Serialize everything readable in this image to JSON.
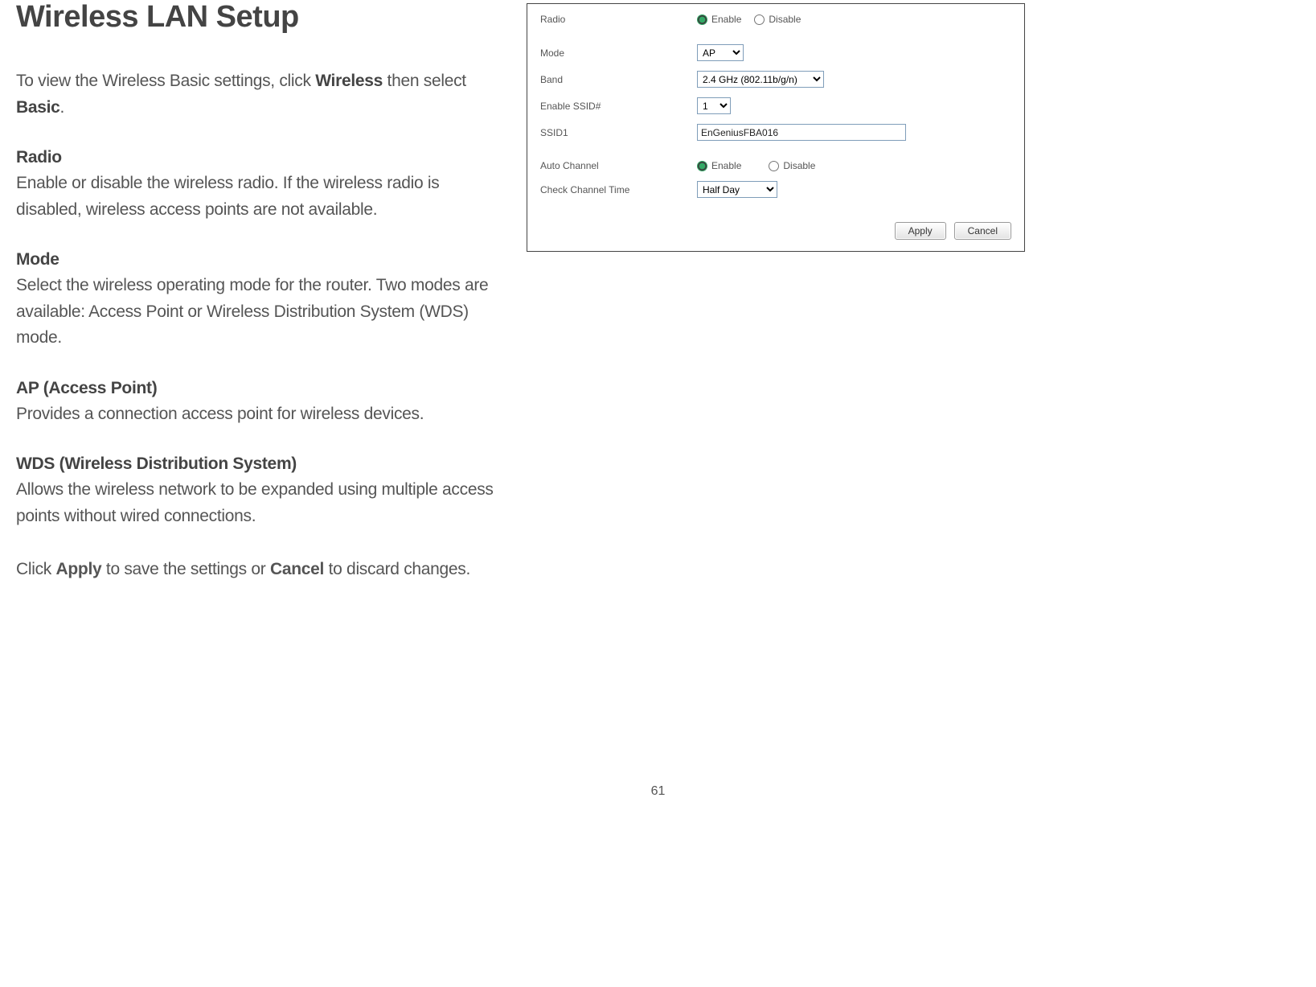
{
  "title": "Wireless LAN Setup",
  "intro": {
    "pre": "To view the Wireless Basic settings, click ",
    "bold1": "Wireless",
    "mid": " then select ",
    "bold2": "Basic",
    "post": "."
  },
  "sections": {
    "radio": {
      "head": "Radio",
      "desc": "Enable or disable the wireless radio. If the wireless radio is disabled, wireless access points are not available."
    },
    "mode": {
      "head": "Mode",
      "desc": "Select the wireless operating mode for the router. Two modes are available: Access Point or Wireless Distribution System (WDS) mode."
    },
    "ap": {
      "head": "AP (Access Point)",
      "desc": "Provides a connection access point for wireless devices."
    },
    "wds": {
      "head": "WDS (Wireless Distribution System)",
      "desc": "Allows the wireless network to be expanded using multiple access points without wired connections."
    }
  },
  "closing": {
    "pre": "Click ",
    "b1": "Apply",
    "mid": " to save the settings or ",
    "b2": "Cancel",
    "post": " to discard changes."
  },
  "panel": {
    "labels": {
      "radio": "Radio",
      "mode": "Mode",
      "band": "Band",
      "enable_ssid": "Enable SSID#",
      "ssid1": "SSID1",
      "auto_channel": "Auto Channel",
      "check_channel_time": "Check Channel Time"
    },
    "options": {
      "enable": "Enable",
      "disable": "Disable"
    },
    "values": {
      "mode": "AP",
      "band": "2.4 GHz (802.11b/g/n)",
      "enable_ssid": "1",
      "ssid1": "EnGeniusFBA016",
      "check_channel_time": "Half Day"
    },
    "buttons": {
      "apply": "Apply",
      "cancel": "Cancel"
    }
  },
  "page_number": "61"
}
